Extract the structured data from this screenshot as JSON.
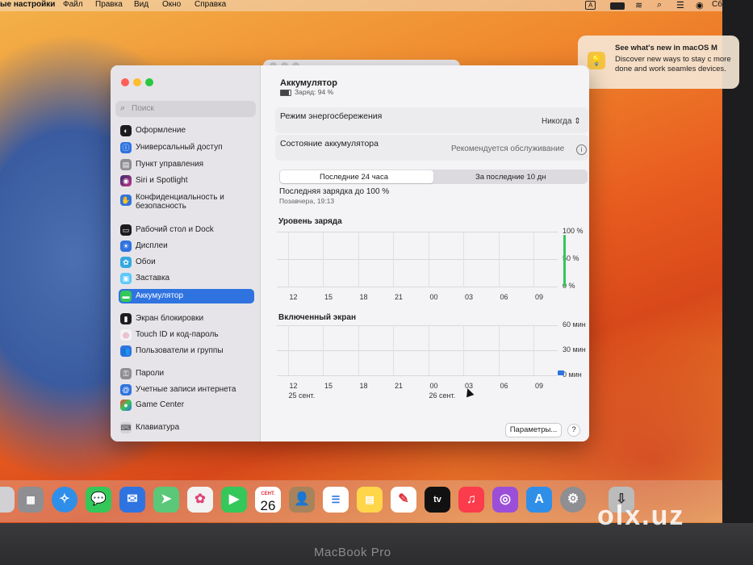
{
  "menubar": {
    "app": "ые настройки",
    "items": [
      "Файл",
      "Правка",
      "Вид",
      "Окно",
      "Справка"
    ],
    "clock": "Сб"
  },
  "notification": {
    "title": "See what's new in macOS M",
    "body": "Discover new ways to stay c more done and work seamles devices."
  },
  "sidebar": {
    "search_placeholder": "Поиск",
    "items": [
      {
        "label": "Оформление",
        "icon": "appearance-icon"
      },
      {
        "label": "Универсальный доступ",
        "icon": "accessibility-icon"
      },
      {
        "label": "Пункт управления",
        "icon": "control-center-icon"
      },
      {
        "label": "Siri и Spotlight",
        "icon": "siri-icon"
      },
      {
        "label": "Конфиденциальность и безопасность",
        "icon": "privacy-hand-icon"
      },
      {
        "label": "Рабочий стол и Dock",
        "icon": "desktop-dock-icon"
      },
      {
        "label": "Дисплеи",
        "icon": "displays-icon"
      },
      {
        "label": "Обои",
        "icon": "wallpaper-icon"
      },
      {
        "label": "Заставка",
        "icon": "screensaver-icon"
      },
      {
        "label": "Аккумулятор",
        "icon": "battery-icon"
      },
      {
        "label": "Экран блокировки",
        "icon": "lock-screen-icon"
      },
      {
        "label": "Touch ID и код-пароль",
        "icon": "touch-id-icon"
      },
      {
        "label": "Пользователи и группы",
        "icon": "users-groups-icon"
      },
      {
        "label": "Пароли",
        "icon": "passwords-key-icon"
      },
      {
        "label": "Учетные записи интернета",
        "icon": "internet-accounts-icon"
      },
      {
        "label": "Game Center",
        "icon": "game-center-icon"
      },
      {
        "label": "Клавиатура",
        "icon": "keyboard-icon"
      }
    ]
  },
  "main": {
    "title": "Аккумулятор",
    "charge": "Заряд: 94 %",
    "low_power_label": "Режим энергосбережения",
    "low_power_value": "Никогда",
    "health_label": "Состояние аккумулятора",
    "health_value": "Рекомендуется обслуживание",
    "tabs": [
      "Последние 24 часа",
      "За последние 10 дн"
    ],
    "last_charge_title": "Последняя зарядка до 100 %",
    "last_charge_time": "Позавчера, 19:13",
    "options_button": "Параметры...",
    "help_button": "?"
  },
  "chart_data": [
    {
      "type": "bar",
      "title": "Уровень заряда",
      "x_ticks": [
        "12",
        "15",
        "18",
        "21",
        "00",
        "03",
        "06",
        "09"
      ],
      "y_ticks": [
        "100 %",
        "50 %",
        "0 %"
      ],
      "ylim": [
        0,
        100
      ],
      "bar_color": "#34c759",
      "bars": [
        {
          "hour": 10.5,
          "value": 94
        }
      ]
    },
    {
      "type": "bar",
      "title": "Включенный экран",
      "x_ticks": [
        "12",
        "15",
        "18",
        "21",
        "00",
        "03",
        "06",
        "09"
      ],
      "date_labels": [
        "25 сент.",
        "26 сент."
      ],
      "y_ticks": [
        "60 мин",
        "30 мин",
        "0 мин"
      ],
      "ylim": [
        0,
        60
      ],
      "bar_color": "#2f73e0",
      "bars": [
        {
          "hour": 10.0,
          "value": 6
        }
      ]
    }
  ],
  "dock": {
    "calendar_month": "СЕНТ.",
    "calendar_day": "26"
  },
  "watermark": "olx.uz",
  "device_label": "MacBook Pro"
}
